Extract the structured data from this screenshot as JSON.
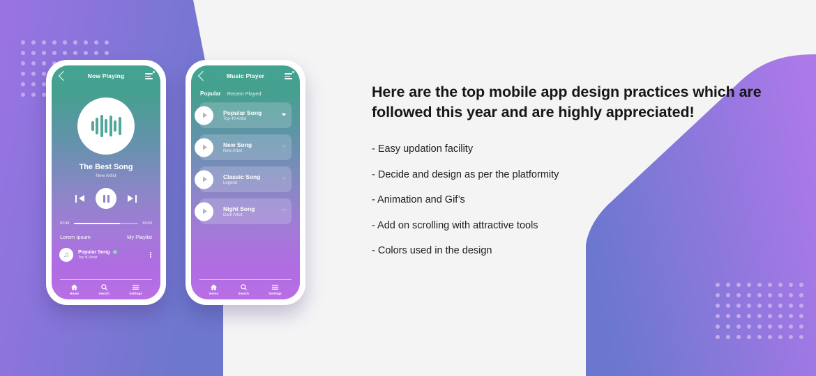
{
  "theme": {
    "page_background": "#f4f4f5",
    "purple_shape_left": "#9a6fe0",
    "blue_shape_right": "#6b77cf",
    "screen_gradient_top": "#43a390",
    "screen_gradient_mid": "#8e85c9",
    "screen_gradient_bottom": "#b86fe4",
    "dot_color": "#c3a8ef"
  },
  "phone_now_playing": {
    "appbar": {
      "back_icon": "chevron-left-icon",
      "title": "Now Playing",
      "menu_icon": "list-menu-icon"
    },
    "album_art_icon": "audio-waveform-icon",
    "song_title": "The Best Song",
    "song_artist": "New Artist",
    "controls": {
      "previous_icon": "skip-previous-icon",
      "play_pause_icon": "pause-icon",
      "next_icon": "skip-next-icon"
    },
    "seek": {
      "elapsed": "02:49",
      "duration": "04:59",
      "progress_percent": 72
    },
    "meta": {
      "left_label": "Lorem Ipsum",
      "right_label": "My Playlist"
    },
    "queue_item": {
      "art_icon": "music-note-icon",
      "title": "Popular Song",
      "verified_icon": "verified-check-icon",
      "artist": "Top 40 Artist",
      "more_icon": "kebab-menu-icon"
    },
    "bottom_nav": [
      {
        "icon": "home-icon",
        "label": "Home"
      },
      {
        "icon": "search-icon",
        "label": "Search"
      },
      {
        "icon": "settings-lines-icon",
        "label": "Settings"
      }
    ]
  },
  "phone_music_list": {
    "appbar": {
      "back_icon": "chevron-left-icon",
      "title": "Music Player",
      "menu_icon": "list-menu-icon"
    },
    "tabs": [
      {
        "label": "Popular",
        "active": true
      },
      {
        "label": "Recent Played",
        "active": false
      }
    ],
    "tracks": [
      {
        "title": "Popular Song",
        "artist": "Top 40 Artist",
        "play_icon": "play-icon",
        "favorite_icon": "heart-filled-icon",
        "favorited": true
      },
      {
        "title": "New Song",
        "artist": "New Artist",
        "play_icon": "play-icon",
        "favorite_icon": "heart-outline-icon",
        "favorited": false
      },
      {
        "title": "Classic Song",
        "artist": "Legend",
        "play_icon": "play-icon",
        "favorite_icon": "heart-outline-icon",
        "favorited": false
      },
      {
        "title": "Night Song",
        "artist": "Dark Artist",
        "play_icon": "play-icon",
        "favorite_icon": "heart-outline-icon",
        "favorited": false
      }
    ],
    "bottom_nav": [
      {
        "icon": "home-icon",
        "label": "Home"
      },
      {
        "icon": "search-icon",
        "label": "Search"
      },
      {
        "icon": "settings-lines-icon",
        "label": "Settings"
      }
    ]
  },
  "content": {
    "headline": "Here are the top mobile app design practices which are followed this year and are highly appreciated!",
    "bullets": [
      "- Easy updation facility",
      "- Decide and design as per the platformity",
      "- Animation and Gif’s",
      "- Add on scrolling with attractive tools",
      "- Colors used in the design"
    ]
  }
}
